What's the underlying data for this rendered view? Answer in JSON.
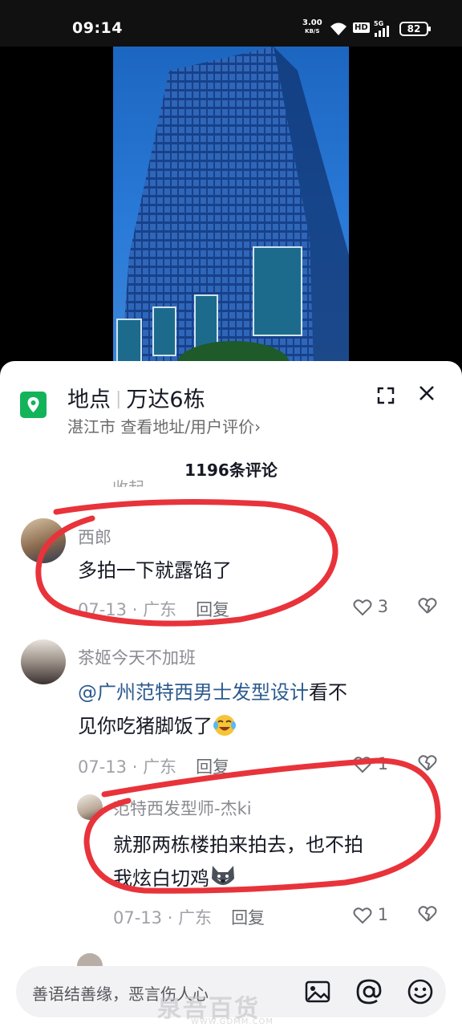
{
  "status_bar": {
    "time": "09:14",
    "net_speed": "3.00",
    "net_unit": "KB/S",
    "hd": "HD",
    "signal": "5G",
    "battery": "82"
  },
  "location": {
    "prefix": "地点",
    "name": "万达6栋",
    "city": "湛江市",
    "link": "查看地址/用户评价›"
  },
  "comments_header": {
    "count_label": "1196条评论"
  },
  "partial_text": "收起",
  "comments": [
    {
      "name": "西郎",
      "text": "多拍一下就露馅了",
      "date": "07-13",
      "region": "广东",
      "reply": "回复",
      "likes": "3"
    },
    {
      "name": "茶姬今天不加班",
      "mention": "@广州范特西男士发型设计",
      "text_after_mention": "看不",
      "text_line2": "见你吃猪脚饭了",
      "emoji": "laughing-tears",
      "date": "07-13",
      "region": "广东",
      "reply": "回复",
      "likes": "1"
    },
    {
      "name": "范特西发型师-杰ki",
      "text_line1": "就那两栋楼拍来拍去，也不拍",
      "text_line2": "我炫白切鸡",
      "emoji": "husky",
      "date": "07-13",
      "region": "广东",
      "reply": "回复",
      "likes": "1"
    }
  ],
  "input": {
    "placeholder": "善语结善缘，恶言伤人心"
  },
  "watermark": {
    "text": "泉吾百货",
    "url": "WWW.GDMM.COM"
  },
  "colors": {
    "pin": "#13b35a",
    "annotation": "#e8333b",
    "mention": "#2b5a8f"
  }
}
